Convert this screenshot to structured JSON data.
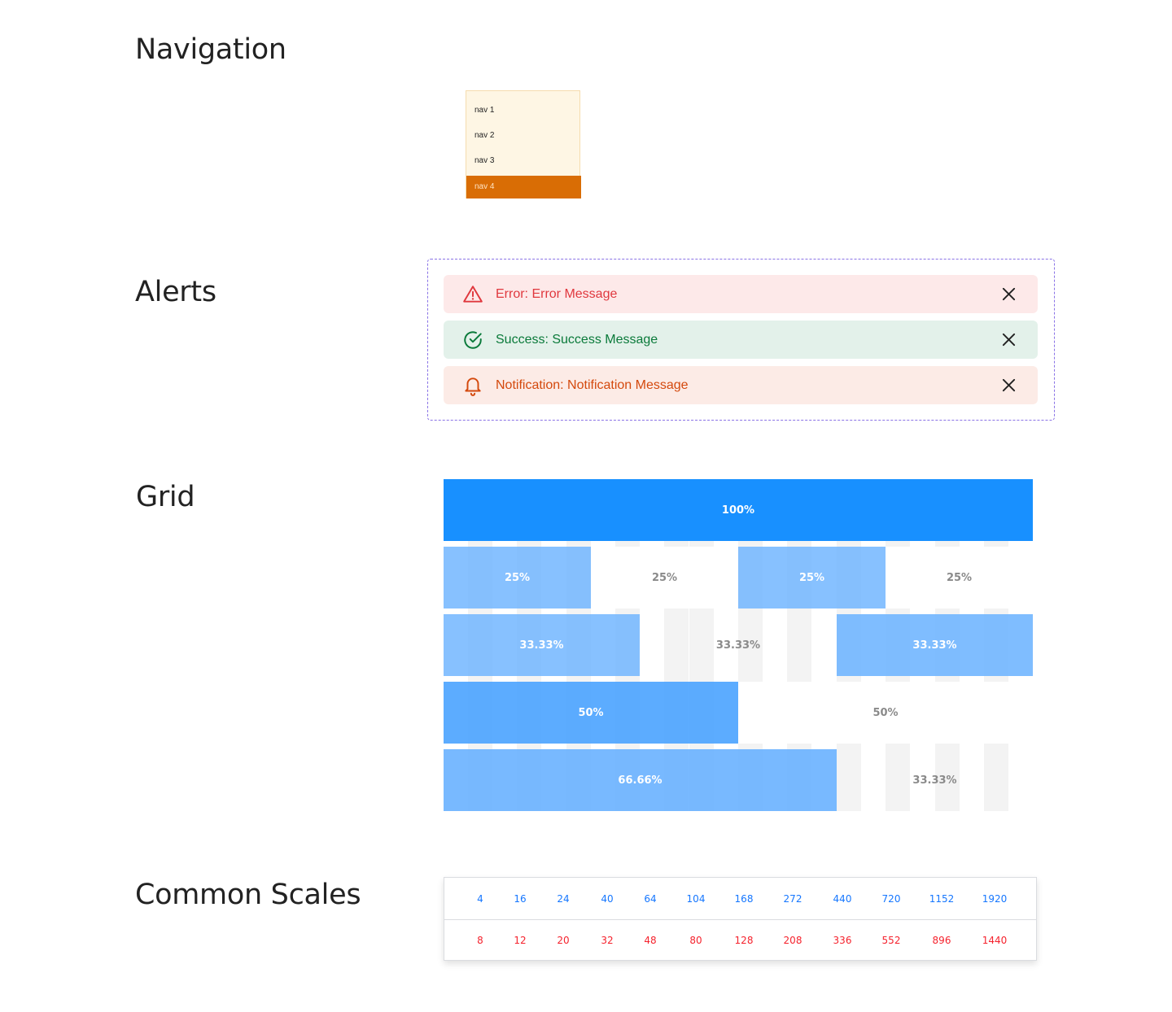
{
  "sections": {
    "navigation": "Navigation",
    "alerts": "Alerts",
    "grid": "Grid",
    "scales": "Common Scales"
  },
  "nav": {
    "items": [
      {
        "label": "nav 1",
        "active": false
      },
      {
        "label": "nav 2",
        "active": false
      },
      {
        "label": "nav 3",
        "active": false
      },
      {
        "label": "nav 4",
        "active": true
      }
    ],
    "colors": {
      "background": "#fef6e4",
      "active": "#d96d05"
    }
  },
  "alerts": [
    {
      "type": "error",
      "icon": "warning-triangle-icon",
      "text": "Error: Error Message",
      "bg": "#fde9e9",
      "color": "#e0383e"
    },
    {
      "type": "success",
      "icon": "check-circle-icon",
      "text": "Success: Success Message",
      "bg": "#e3f1ea",
      "color": "#0a7a3a"
    },
    {
      "type": "notification",
      "icon": "bell-icon",
      "text": "Notification: Notification Message",
      "bg": "#fcebe6",
      "color": "#d4490d"
    }
  ],
  "grid": {
    "rows": [
      [
        {
          "label": "100%",
          "fill": true
        }
      ],
      [
        {
          "label": "25%",
          "fill": true
        },
        {
          "label": "25%",
          "fill": false
        },
        {
          "label": "25%",
          "fill": true
        },
        {
          "label": "25%",
          "fill": false
        }
      ],
      [
        {
          "label": "33.33%",
          "fill": true
        },
        {
          "label": "33.33%",
          "fill": false
        },
        {
          "label": "33.33%",
          "fill": true
        }
      ],
      [
        {
          "label": "50%",
          "fill": true
        },
        {
          "label": "50%",
          "fill": false
        }
      ],
      [
        {
          "label": "66.66%",
          "fill": true
        },
        {
          "label": "33.33%",
          "fill": false
        }
      ]
    ],
    "colors": {
      "full": "#1890ff",
      "cell": "#69b1ff"
    }
  },
  "scales": {
    "row1": [
      "4",
      "16",
      "24",
      "40",
      "64",
      "104",
      "168",
      "272",
      "440",
      "720",
      "1152",
      "1920"
    ],
    "row2": [
      "8",
      "12",
      "20",
      "32",
      "48",
      "80",
      "128",
      "208",
      "336",
      "552",
      "896",
      "1440"
    ],
    "colors": {
      "row1": "#1677ff",
      "row2": "#f5222d"
    }
  }
}
